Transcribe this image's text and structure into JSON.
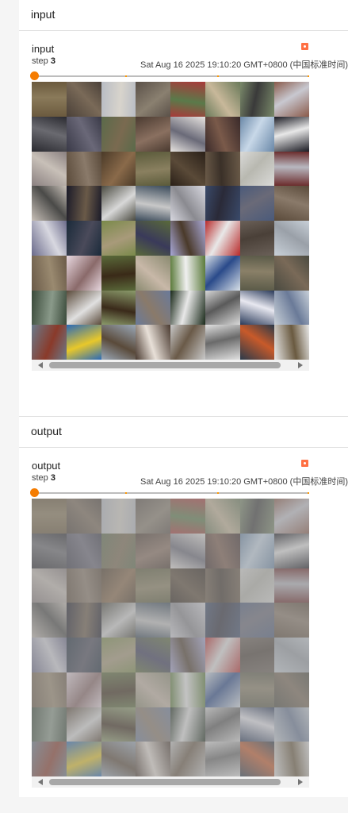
{
  "sections": [
    {
      "header": "input",
      "card": {
        "title": "input",
        "step_label": "step",
        "step_value": "3",
        "date": "Sat Aug 16 2025 19:10:20 GMT+0800 (中国标准时间)"
      }
    },
    {
      "header": "output",
      "card": {
        "title": "output",
        "step_label": "step",
        "step_value": "3",
        "date": "Sat Aug 16 2025 19:10:20 GMT+0800 (中国标准时间)"
      }
    }
  ],
  "colors": {
    "accent": "#f57c00",
    "expand": "#ff7043"
  }
}
